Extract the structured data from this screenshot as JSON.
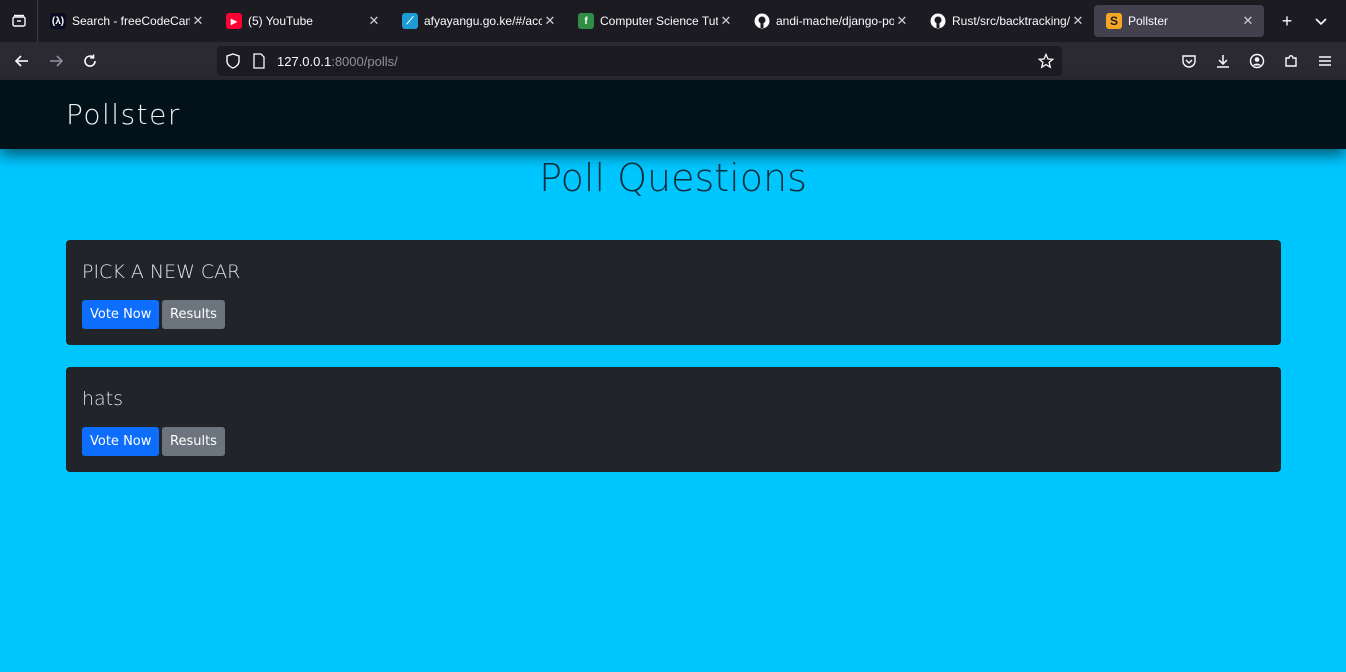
{
  "browser": {
    "tabs": [
      {
        "title": "Search - freeCodeCamp",
        "favicon_glyph": "A",
        "favicon_color": "#0a0a23",
        "favicon_fg": "#ffffff"
      },
      {
        "title": "(5) YouTube",
        "favicon_glyph": "▶",
        "favicon_color": "#ff0033",
        "favicon_fg": "#ffffff"
      },
      {
        "title": "afyayangu.go.ke/#/acc",
        "favicon_glyph": "✓",
        "favicon_color": "#1e9bd7",
        "favicon_fg": "#ffffff"
      },
      {
        "title": "Computer Science Tuto",
        "favicon_glyph": "f",
        "favicon_color": "#2f8d46",
        "favicon_fg": "#ffffff"
      },
      {
        "title": "andi-mache/django-po",
        "favicon_glyph": "●",
        "favicon_color": "#1c1b22",
        "favicon_fg": "#ffffff"
      },
      {
        "title": "Rust/src/backtracking/",
        "favicon_glyph": "●",
        "favicon_color": "#1c1b22",
        "favicon_fg": "#ffffff"
      },
      {
        "title": "Pollster",
        "favicon_glyph": "S",
        "favicon_color": "#f5a623",
        "favicon_fg": "#1c1b22",
        "active": true
      }
    ],
    "url_host": "127.0.0.1",
    "url_path": ":8000/polls/"
  },
  "site": {
    "brand": "Pollster",
    "page_title": "Poll Questions"
  },
  "polls": [
    {
      "question": "PICK A NEW CAR",
      "vote_label": "Vote Now",
      "results_label": "Results"
    },
    {
      "question": "hats",
      "vote_label": "Vote Now",
      "results_label": "Results"
    }
  ]
}
